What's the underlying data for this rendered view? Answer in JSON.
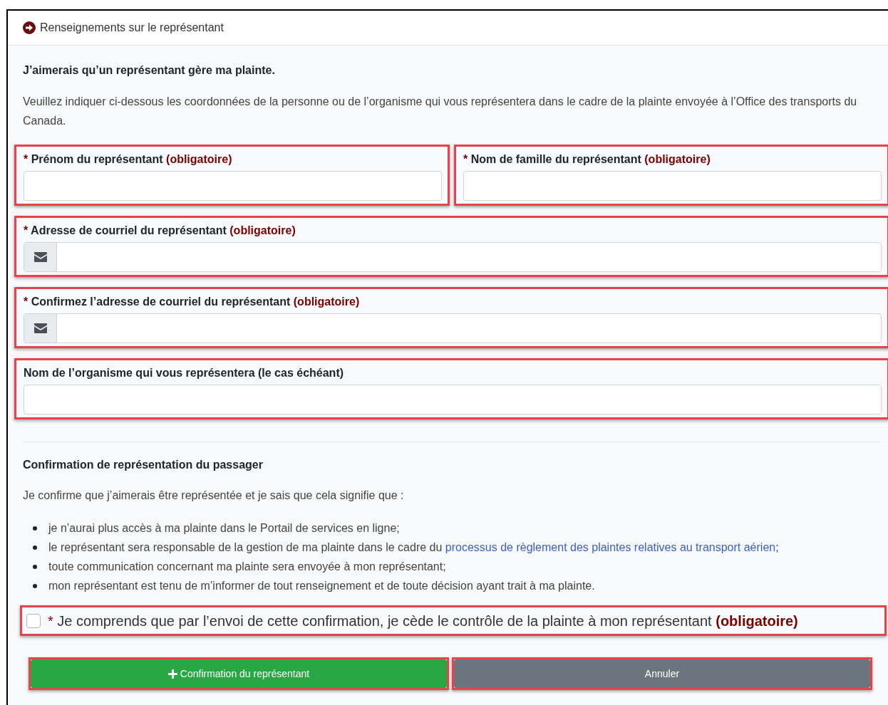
{
  "header": {
    "title": "Renseignements sur le représentant"
  },
  "intro": {
    "heading": "J’aimerais qu’un représentant gère ma plainte.",
    "text": "Veuillez indiquer ci-dessous les coordonnées de la personne ou de l’organisme qui vous représentera dans le cadre de la plainte envoyée à l’Office des transports du Canada."
  },
  "field_rows": [
    {
      "fields": [
        {
          "kind": "text",
          "marker": "*",
          "label": "Prénom du représentant",
          "note": "(obligatoire)"
        },
        {
          "kind": "text",
          "marker": "*",
          "label": "Nom de famille du représentant",
          "note": "(obligatoire)"
        }
      ]
    },
    {
      "fields": [
        {
          "kind": "email",
          "marker": "*",
          "label": "Adresse de courriel du représentant",
          "note": "(obligatoire)"
        }
      ]
    },
    {
      "fields": [
        {
          "kind": "email",
          "marker": "*",
          "label": "Confirmez l’adresse de courriel du représentant",
          "note": "(obligatoire)"
        }
      ]
    },
    {
      "fields": [
        {
          "kind": "text",
          "label": "Nom de l’organisme qui vous représentera (le cas échéant)"
        }
      ]
    }
  ],
  "confirmation": {
    "heading": "Confirmation de représentation du passager",
    "intro": "Je confirme que j’aimerais être représentée et je sais que cela signifie que :",
    "bullets": [
      {
        "text": "je n’aurai plus accès à ma plainte dans le Portail de services en ligne;"
      },
      {
        "text": "le représentant sera responsable de la gestion de ma plainte dans le cadre du",
        "link": "processus de règlement des plaintes relatives au transport aérien",
        "after": ";"
      },
      {
        "text": "toute communication concernant ma plainte sera envoyée à mon représentant;"
      },
      {
        "text": "mon représentant est tenu de m’informer de tout renseignement et de toute décision ayant trait à ma plainte."
      }
    ]
  },
  "agreement": {
    "checked": false,
    "marker": "*",
    "label": "Je comprends que par l’envoi de cette confirmation, je cède le contrôle de la plainte à mon représentant",
    "note": "(obligatoire)"
  },
  "buttons": [
    {
      "kind": "primary",
      "label": "Confirmation du représentant"
    },
    {
      "kind": "secondary",
      "label": "Annuler"
    }
  ]
}
